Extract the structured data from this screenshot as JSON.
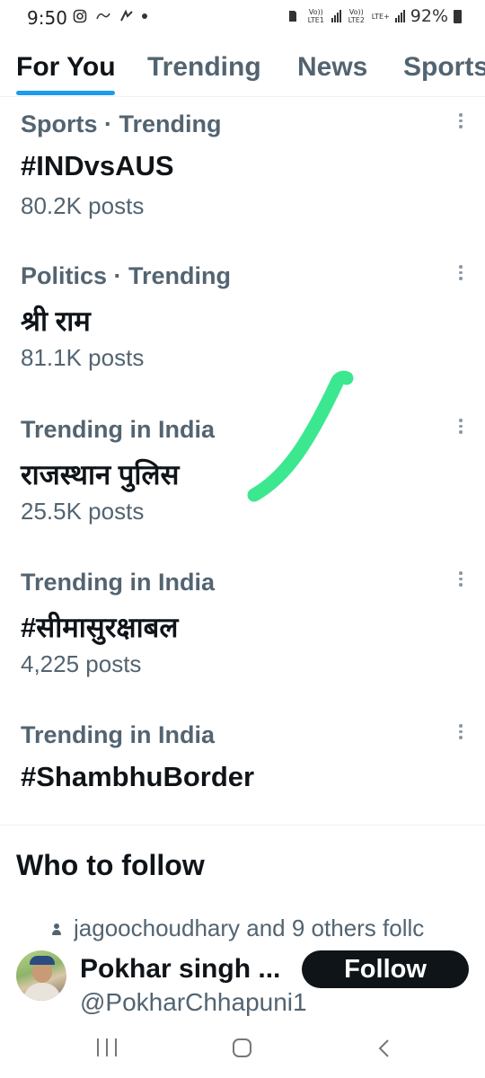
{
  "status_bar": {
    "time": "9:50",
    "left_icons": [
      "instagram-icon",
      "notification-icon",
      "app-icon",
      "dot-icon"
    ],
    "network_1": "Vo)) LTE1",
    "network_2": "Vo)) LTE2",
    "network_2_type": "LTE+",
    "battery": "92%"
  },
  "tabs": [
    {
      "label": "For You",
      "active": true
    },
    {
      "label": "Trending",
      "active": false
    },
    {
      "label": "News",
      "active": false
    },
    {
      "label": "Sports",
      "active": false
    }
  ],
  "trends": [
    {
      "context": "Sports · Trending",
      "topic": "#INDvsAUS",
      "posts": "80.2K posts"
    },
    {
      "context": "Politics · Trending",
      "topic": "श्री राम",
      "posts": "81.1K posts"
    },
    {
      "context": "Trending in India",
      "topic": "राजस्थान पुलिस",
      "posts": "25.5K posts"
    },
    {
      "context": "Trending in India",
      "topic": "#सीमासुरक्षाबल",
      "posts": "4,225 posts"
    },
    {
      "context": "Trending in India",
      "topic": "#ShambhuBorder",
      "posts": ""
    }
  ],
  "who_to_follow": {
    "title": "Who to follow",
    "social_context": "jagoochoudhary and 9 others follc",
    "name": "Pokhar singh ...",
    "handle": "@PokharChhapuni1",
    "follow_label": "Follow"
  },
  "colors": {
    "accent": "#1d9bf0",
    "text_primary": "#0f1419",
    "text_secondary": "#536471",
    "annotation_stroke": "#3be88f"
  }
}
